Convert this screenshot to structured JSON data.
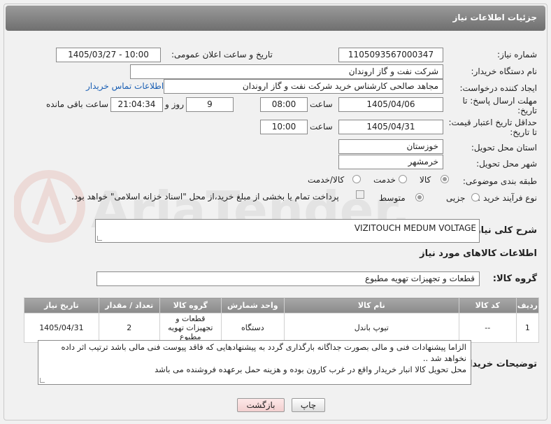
{
  "header": {
    "title": "جزئیات اطلاعات نیاز"
  },
  "form": {
    "need_number_label": "شماره نیاز:",
    "need_number": "1105093567000347",
    "announce_label": "تاریخ و ساعت اعلان عمومی:",
    "announce_value": "1405/03/27 - 10:00",
    "buyer_org_label": "نام دستگاه خریدار:",
    "buyer_org": "شرکت نفت و گاز اروندان",
    "requester_label": "ایجاد کننده درخواست:",
    "requester": "مجاهد صالحی کارشناس خرید شرکت نفت و گاز اروندان",
    "buyer_contact_link": "اطلاعات تماس خریدار",
    "reply_deadline_label_1": "مهلت ارسال پاسخ: تا",
    "reply_deadline_label_2": "تاریخ:",
    "reply_date": "1405/04/06",
    "hour_label": "ساعت",
    "reply_time": "08:00",
    "days_value": "9",
    "days_label": "روز و",
    "remaining_value": "21:04:34",
    "remaining_label": "ساعت باقی مانده",
    "price_deadline_label_1": "حداقل تاریخ اعتبار قیمت:",
    "price_deadline_label_2": "تا تاریخ:",
    "price_date": "1405/04/31",
    "price_hour_label": "ساعت",
    "price_time": "10:00",
    "province_label": "استان محل تحویل:",
    "province": "خوزستان",
    "city_label": "شهر محل تحویل:",
    "city": "خرمشهر",
    "category_label": "طبقه بندی موضوعی:",
    "category_options": [
      "کالا",
      "خدمت",
      "کالا/خدمت"
    ],
    "process_label": "نوع فرآیند خرید :",
    "process_options": [
      "جزیی",
      "متوسط"
    ],
    "payment_note": "پرداخت تمام یا بخشی از مبلغ خرید،از محل \"اسناد خزانه اسلامی\" خواهد بود.",
    "description_label": "شرح کلی نیاز:",
    "description": "VIZITOUCH MEDUM VOLTAGE",
    "goods_info_title": "اطلاعات کالاهای مورد نیاز",
    "goods_group_label": "گروه کالا:",
    "goods_group": "قطعات و تجهیزات تهویه مطبوع",
    "buyer_notes_label": "توضیحات خریدار:",
    "buyer_notes_line1": "الزاما  پیشنهادات فنی و مالی بصورت جداگانه بارگذاری گردد به پیشنهادهایی که فاقد پیوست فنی مالی باشد ترتیب اثر داده نخواهد شد ..",
    "buyer_notes_line2": "محل تحویل کالا انبار خریدار واقع در غرب کارون بوده و هزینه حمل برعهده فروشنده می باشد"
  },
  "table": {
    "headers": [
      "ردیف",
      "کد کالا",
      "نام کالا",
      "واحد شمارش",
      "گروه کالا",
      "تعداد / مقدار",
      "تاریخ نیاز"
    ],
    "rows": [
      [
        "1",
        "--",
        "تیوپ باندل",
        "دستگاه",
        "قطعات و تجهیزات تهویه مطبوع",
        "2",
        "1405/04/31"
      ]
    ]
  },
  "buttons": {
    "print": "چاپ",
    "back": "بازگشت"
  },
  "watermark": {
    "text": "AriaTender.neT"
  },
  "colors": {
    "header": "#7f7f7f",
    "link": "#1a5fb4",
    "back_button": "#f6d6d6"
  }
}
